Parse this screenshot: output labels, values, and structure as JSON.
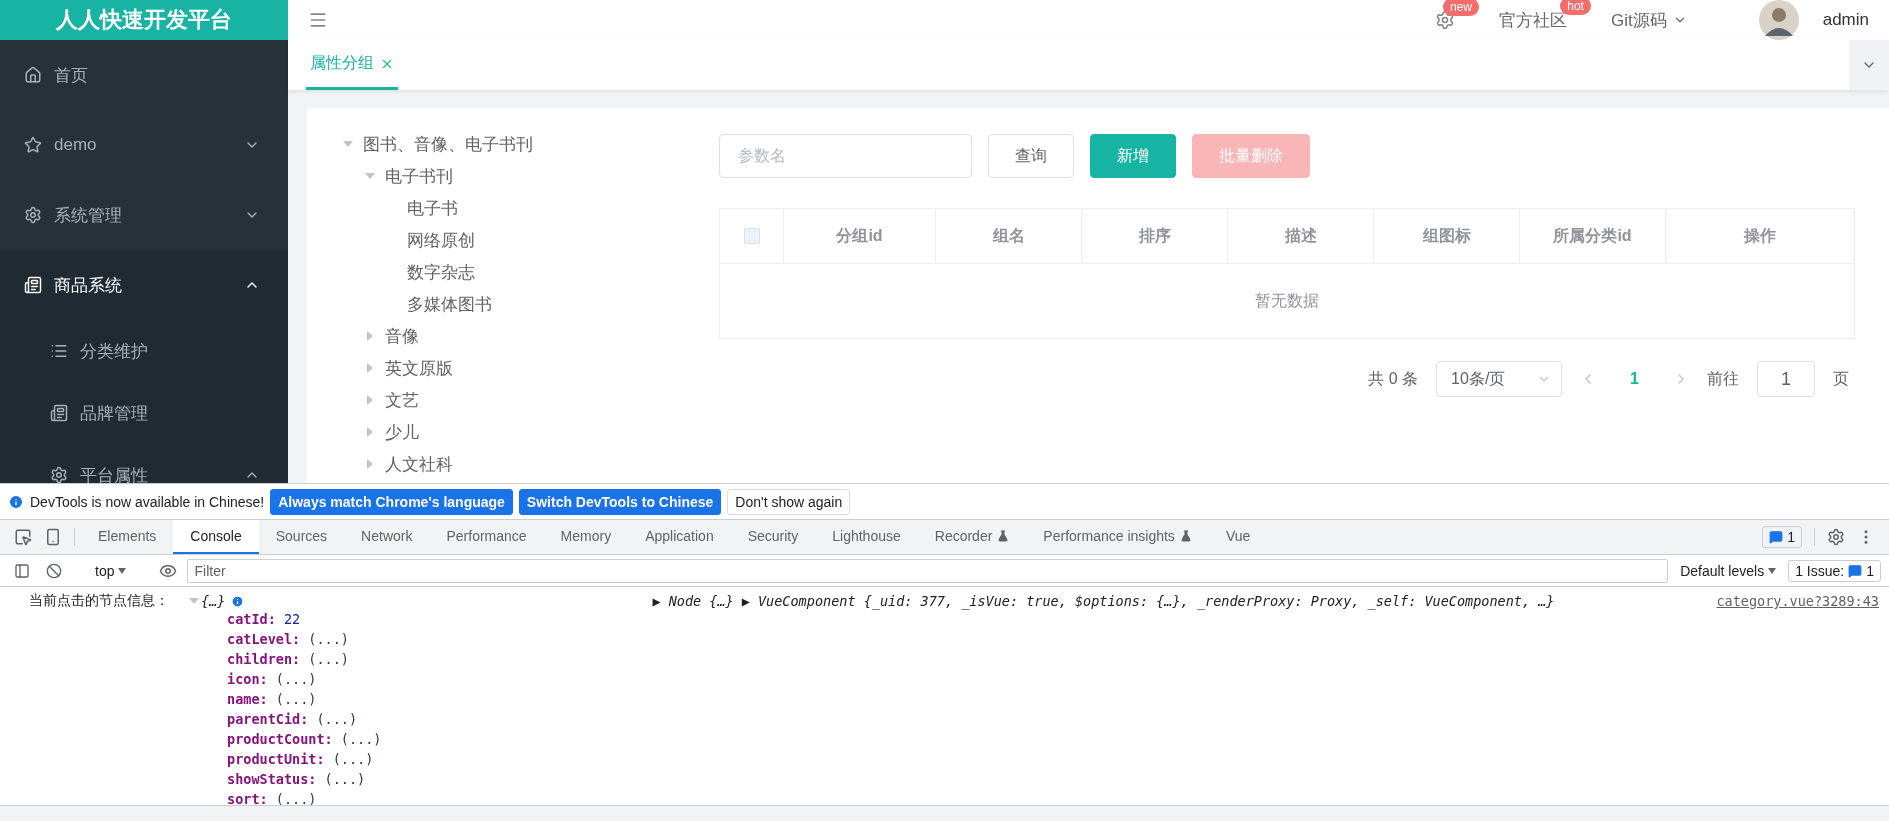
{
  "app": {
    "title": "人人快速开发平台"
  },
  "sidebar": {
    "items": [
      {
        "label": "首页",
        "kind": "link"
      },
      {
        "label": "demo",
        "kind": "submenu",
        "expanded": false,
        "active": false
      },
      {
        "label": "系统管理",
        "kind": "submenu",
        "expanded": false,
        "active": false
      },
      {
        "label": "商品系统",
        "kind": "submenu",
        "expanded": true,
        "active": true,
        "children": [
          {
            "label": "分类维护",
            "kind": "link"
          },
          {
            "label": "品牌管理",
            "kind": "link"
          },
          {
            "label": "平台属性",
            "kind": "submenu",
            "expanded": true,
            "active": false
          }
        ]
      }
    ]
  },
  "header": {
    "links": [
      {
        "label": "官方社区",
        "badge": "hot"
      },
      {
        "label": "Git源码",
        "dropdown": true
      }
    ],
    "settings_badge": "new",
    "user": "admin"
  },
  "tabs": [
    {
      "label": "属性分组",
      "selected": true
    }
  ],
  "tree": [
    {
      "label": "图书、音像、电子书刊",
      "kind": "branch",
      "expanded": true,
      "children": [
        {
          "label": "电子书刊",
          "kind": "branch",
          "expanded": true,
          "children": [
            {
              "label": "电子书",
              "kind": "leaf"
            },
            {
              "label": "网络原创",
              "kind": "leaf"
            },
            {
              "label": "数字杂志",
              "kind": "leaf"
            },
            {
              "label": "多媒体图书",
              "kind": "leaf"
            }
          ]
        },
        {
          "label": "音像",
          "kind": "branch",
          "expanded": false
        },
        {
          "label": "英文原版",
          "kind": "branch",
          "expanded": false
        },
        {
          "label": "文艺",
          "kind": "branch",
          "expanded": false
        },
        {
          "label": "少儿",
          "kind": "branch",
          "expanded": false
        },
        {
          "label": "人文社科",
          "kind": "branch",
          "expanded": false
        }
      ]
    }
  ],
  "search": {
    "placeholder": "参数名"
  },
  "buttons": [
    {
      "label": "查询",
      "kind": "default",
      "disabled": false
    },
    {
      "label": "新增",
      "kind": "primary",
      "disabled": false
    },
    {
      "label": "批量删除",
      "kind": "danger",
      "disabled": true
    }
  ],
  "table": {
    "select_all": {
      "checked": false
    },
    "columns": [
      "分组id",
      "组名",
      "排序",
      "描述",
      "组图标",
      "所属分类id",
      "操作"
    ],
    "empty_text": "暂无数据"
  },
  "pagination": {
    "total": "共 0 条",
    "page_size": "10条/页",
    "pages": [
      {
        "label": "1",
        "selected": true
      }
    ],
    "goto_label": "前往",
    "goto_value": "1",
    "page_unit": "页"
  },
  "devtools": {
    "infobar": {
      "message": "DevTools is now available in Chinese!",
      "buttons": [
        {
          "label": "Always match Chrome's language",
          "kind": "primary"
        },
        {
          "label": "Switch DevTools to Chinese",
          "kind": "primary"
        },
        {
          "label": "Don't show again",
          "kind": "default"
        }
      ]
    },
    "tabs": [
      {
        "label": "Elements",
        "selected": false,
        "experimental": false
      },
      {
        "label": "Console",
        "selected": true,
        "experimental": false
      },
      {
        "label": "Sources",
        "selected": false,
        "experimental": false
      },
      {
        "label": "Network",
        "selected": false,
        "experimental": false
      },
      {
        "label": "Performance",
        "selected": false,
        "experimental": false
      },
      {
        "label": "Memory",
        "selected": false,
        "experimental": false
      },
      {
        "label": "Application",
        "selected": false,
        "experimental": false
      },
      {
        "label": "Security",
        "selected": false,
        "experimental": false
      },
      {
        "label": "Lighthouse",
        "selected": false,
        "experimental": false
      },
      {
        "label": "Recorder",
        "selected": false,
        "experimental": true
      },
      {
        "label": "Performance insights",
        "selected": false,
        "experimental": true
      },
      {
        "label": "Vue",
        "selected": false,
        "experimental": false
      }
    ],
    "message_count": "1",
    "toolbar": {
      "context": "top",
      "filter_placeholder": "Filter",
      "levels": "Default levels",
      "issues_label": "1 Issue:",
      "issues_count": "1"
    },
    "log": {
      "label": "当前点击的节点信息：",
      "preview": "{…}",
      "args": [
        {
          "arrow": "▶",
          "text": "Node {…}"
        },
        {
          "arrow": "▶",
          "text": "VueComponent {_uid: 377, _isVue: true, $options: {…}, _renderProxy: Proxy, _self: VueComponent, …}"
        }
      ],
      "source": "category.vue?3289:43",
      "properties": [
        {
          "key": "catId:",
          "value": "22",
          "kind": "number"
        },
        {
          "key": "catLevel:",
          "value": "(...)",
          "kind": "getter"
        },
        {
          "key": "children:",
          "value": "(...)",
          "kind": "getter"
        },
        {
          "key": "icon:",
          "value": "(...)",
          "kind": "getter"
        },
        {
          "key": "name:",
          "value": "(...)",
          "kind": "getter"
        },
        {
          "key": "parentCid:",
          "value": "(...)",
          "kind": "getter"
        },
        {
          "key": "productCount:",
          "value": "(...)",
          "kind": "getter"
        },
        {
          "key": "productUnit:",
          "value": "(...)",
          "kind": "getter"
        },
        {
          "key": "showStatus:",
          "value": "(...)",
          "kind": "getter"
        },
        {
          "key": "sort:",
          "value": "(...)",
          "kind": "getter"
        }
      ]
    }
  }
}
